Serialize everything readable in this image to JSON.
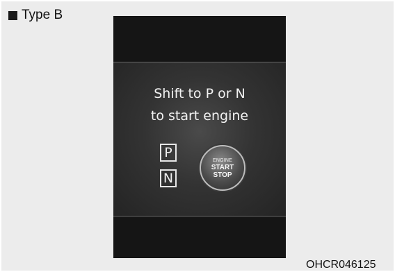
{
  "type_label": "Type B",
  "display": {
    "message_line1": "Shift to P or N",
    "message_line2": "to start engine",
    "gear_p": "P",
    "gear_n": "N",
    "button": {
      "line1": "ENGINE",
      "line2": "START",
      "line3": "STOP"
    }
  },
  "figure_code": "OHCR046125"
}
